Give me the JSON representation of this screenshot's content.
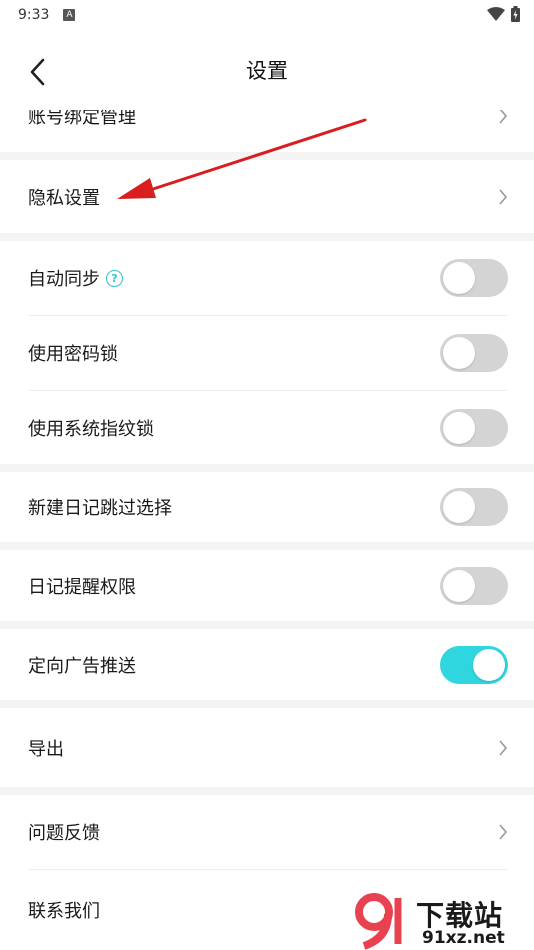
{
  "status_bar": {
    "time": "9:33",
    "notification_letter": "A"
  },
  "header": {
    "title": "设置"
  },
  "rows": {
    "account_binding": "账号绑定管理",
    "privacy": "隐私设置",
    "auto_sync": "自动同步",
    "password_lock": "使用密码锁",
    "fingerprint_lock": "使用系统指纹锁",
    "skip_selection": "新建日记跳过选择",
    "reminder_permission": "日记提醒权限",
    "ad_push": "定向广告推送",
    "export": "导出",
    "feedback": "问题反馈",
    "contact": "联系我们"
  },
  "toggles": {
    "auto_sync": false,
    "password_lock": false,
    "fingerprint_lock": false,
    "skip_selection": false,
    "reminder_permission": false,
    "ad_push": true
  },
  "watermark": {
    "main": "下载站",
    "sub": "91xz.net"
  },
  "colors": {
    "accent": "#2fd5df",
    "toggle_off": "#d4d4d4",
    "arrow": "#d81e1e"
  }
}
